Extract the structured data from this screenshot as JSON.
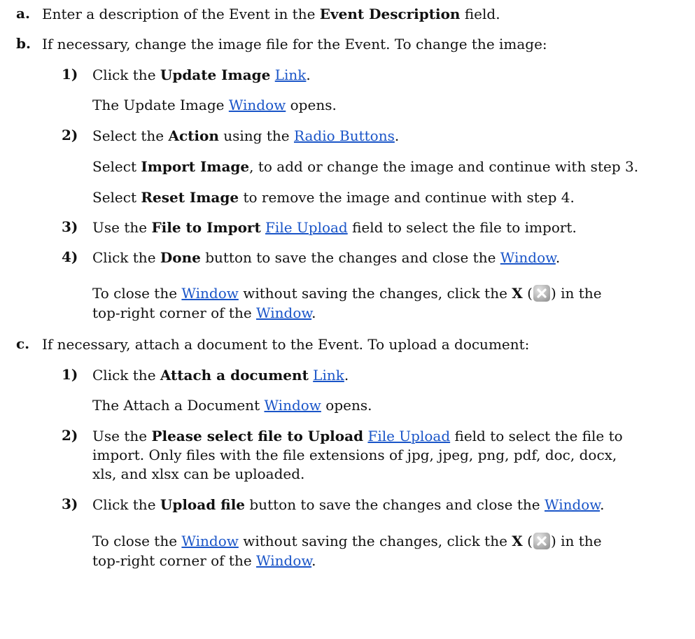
{
  "step_a": {
    "marker": "a.",
    "text1": "Enter a description of the Event in the ",
    "bold1": "Event Description",
    "text2": " field."
  },
  "step_b": {
    "marker": "b.",
    "text1": "If necessary, change the image file for the Event. To change the image:",
    "sub1": {
      "marker": "1)",
      "text1": "Click the ",
      "bold1": "Update Image",
      "link1": "Link",
      "text2": ".",
      "note_text1": "The Update Image ",
      "note_link1": "Window",
      "note_text2": " opens."
    },
    "sub2": {
      "marker": "2)",
      "text1": "Select the ",
      "bold1": "Action",
      "text2": " using the ",
      "link1": "Radio Buttons",
      "text3": ".",
      "p1_text1": "Select ",
      "p1_bold1": "Import Image",
      "p1_text2": ", to add or change the image and continue with step 3.",
      "p2_text1": "Select ",
      "p2_bold1": "Reset Image",
      "p2_text2": " to remove the image and continue with step 4."
    },
    "sub3": {
      "marker": "3)",
      "text1": "Use the ",
      "bold1": "File to Import",
      "link1": "File Upload",
      "text2": " field to select the file to import."
    },
    "sub4": {
      "marker": "4)",
      "text1": "Click the ",
      "bold1": "Done",
      "text2": " button to save the changes and close the ",
      "link1": "Window",
      "text3": ".",
      "close_text1": "To close the ",
      "close_link1": "Window",
      "close_text2": " without saving the changes, click the ",
      "close_bold1": "X",
      "close_text3": " (",
      "close_text4": ") in the",
      "close_line2_text1": "top-right corner of the ",
      "close_line2_link1": "Window",
      "close_line2_text2": "."
    }
  },
  "step_c": {
    "marker": "c.",
    "text1": "If necessary, attach a document to the Event. To upload a document:",
    "sub1": {
      "marker": "1)",
      "text1": "Click the ",
      "bold1": "Attach a document",
      "link1": "Link",
      "text2": ".",
      "note_text1": "The Attach a Document ",
      "note_link1": "Window",
      "note_text2": " opens."
    },
    "sub2": {
      "marker": "2)",
      "text1": "Use the ",
      "bold1": "Please select file to Upload",
      "link1": "File Upload",
      "text2": " field to select the file to",
      "line2": "import. Only files with the file extensions of jpg, jpeg, png, pdf, doc, docx,",
      "line3": "xls, and xlsx can be uploaded."
    },
    "sub3": {
      "marker": "3)",
      "text1": "Click the ",
      "bold1": "Upload file",
      "text2": " button to save the changes and close the ",
      "link1": "Window",
      "text3": ".",
      "close_text1": "To close the ",
      "close_link1": "Window",
      "close_text2": " without saving the changes, click the ",
      "close_bold1": "X",
      "close_text3": " (",
      "close_text4": ") in the",
      "close_line2_text1": "top-right corner of the ",
      "close_line2_link1": "Window",
      "close_line2_text2": "."
    }
  },
  "colors": {
    "link": "#1a55c8",
    "text": "#111111"
  },
  "icons": {
    "close": "close-x-icon"
  }
}
